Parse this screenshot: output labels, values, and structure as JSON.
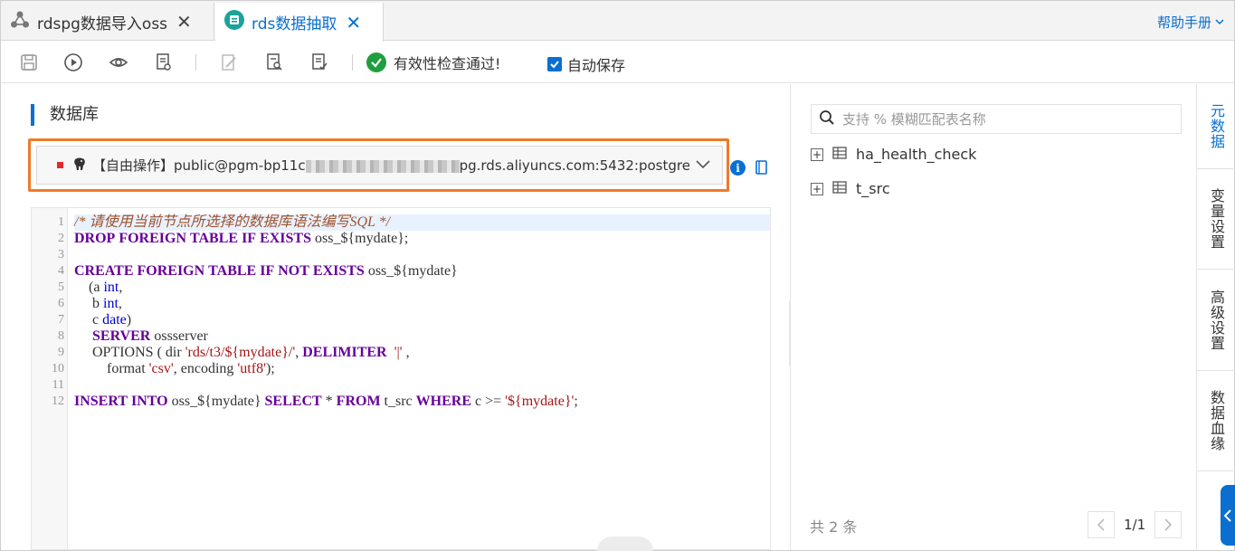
{
  "tabs": [
    {
      "label": "rdspg数据导入oss",
      "icon": "node-graph-icon",
      "active": false
    },
    {
      "label": "rds数据抽取",
      "icon": "database-node-icon",
      "active": true
    }
  ],
  "help": {
    "label": "帮助手册"
  },
  "toolbar": {
    "validation": "有效性检查通过!",
    "autosave": "自动保存"
  },
  "left": {
    "section_title": "数据库",
    "db_prefix": "【自由操作】public@pgm-bp11c",
    "db_suffix": "pg.rds.aliyuncs.com:5432:postgre"
  },
  "editor": {
    "lines": [
      "/* 请使用当前节点所选择的数据库语法编写SQL */",
      "DROP FOREIGN TABLE IF EXISTS oss_${mydate};",
      "",
      "CREATE FOREIGN TABLE IF NOT EXISTS oss_${mydate}",
      "    (a int,",
      "     b int,",
      "     c date)",
      "     SERVER ossserver",
      "     OPTIONS ( dir 'rds/t3/${mydate}/', DELIMITER  '|' ,",
      "         format 'csv', encoding 'utf8');",
      "",
      "INSERT INTO oss_${mydate} SELECT * FROM t_src WHERE c >= '${mydate}';"
    ]
  },
  "right": {
    "search_placeholder": "支持 % 模糊匹配表名称",
    "tables": [
      "ha_health_check",
      "t_src"
    ],
    "count": "共 2 条",
    "page": "1/1"
  },
  "sidetabs": [
    "元数据",
    "变量设置",
    "高级设置",
    "数据血缘"
  ],
  "colors": {
    "accent": "#0a6fd1",
    "ok": "#1e9e3e",
    "highlight": "#f07a28"
  }
}
